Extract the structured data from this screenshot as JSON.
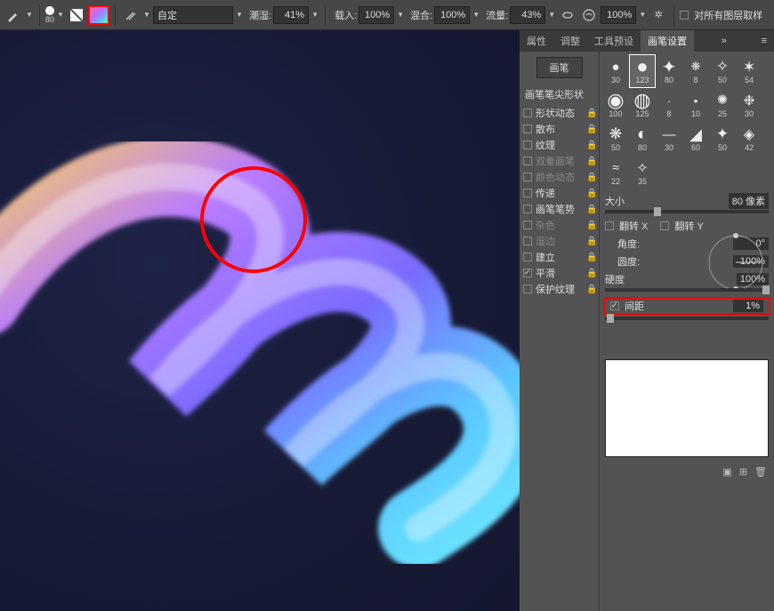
{
  "toolbar": {
    "brush_size": "80",
    "mode_value": "自定",
    "opacity_label": "潮湿:",
    "opacity_value": "41%",
    "load_label": "载入:",
    "load_value": "100%",
    "mix_label": "混合:",
    "mix_value": "100%",
    "flow_label": "流量:",
    "flow_value": "43%",
    "smooth_value": "100%",
    "all_layers_label": "对所有图层取样"
  },
  "tabs": {
    "t1": "属性",
    "t2": "调整",
    "t3": "工具预设",
    "t4": "画笔设置",
    "more": "»"
  },
  "sidebar": {
    "brush_btn": "画笔",
    "tip_shape": "画笔笔尖形状",
    "opts": [
      {
        "label": "形状动态",
        "enabled": true,
        "checked": false
      },
      {
        "label": "散布",
        "enabled": true,
        "checked": false
      },
      {
        "label": "纹理",
        "enabled": true,
        "checked": false
      },
      {
        "label": "双重画笔",
        "enabled": false,
        "checked": false
      },
      {
        "label": "颜色动态",
        "enabled": false,
        "checked": false
      },
      {
        "label": "传递",
        "enabled": true,
        "checked": false
      },
      {
        "label": "画笔笔势",
        "enabled": true,
        "checked": false
      },
      {
        "label": "杂色",
        "enabled": false,
        "checked": false
      },
      {
        "label": "湿边",
        "enabled": false,
        "checked": false
      },
      {
        "label": "建立",
        "enabled": true,
        "checked": false
      },
      {
        "label": "平滑",
        "enabled": true,
        "checked": true
      },
      {
        "label": "保护纹理",
        "enabled": true,
        "checked": false
      }
    ]
  },
  "thumbs": [
    {
      "sz": "30"
    },
    {
      "sz": "123",
      "sel": true
    },
    {
      "sz": "80"
    },
    {
      "sz": "8"
    },
    {
      "sz": "50"
    },
    {
      "sz": "54"
    },
    {
      "sz": "100"
    },
    {
      "sz": "125"
    },
    {
      "sz": "8"
    },
    {
      "sz": "10"
    },
    {
      "sz": "25"
    },
    {
      "sz": "30"
    },
    {
      "sz": "50"
    },
    {
      "sz": "80"
    },
    {
      "sz": "30"
    },
    {
      "sz": "60"
    },
    {
      "sz": "50"
    },
    {
      "sz": "42"
    },
    {
      "sz": "22"
    },
    {
      "sz": "35"
    }
  ],
  "props": {
    "size_label": "大小",
    "size_value": "80 像素",
    "flipx_label": "翻转 X",
    "flipy_label": "翻转 Y",
    "angle_label": "角度:",
    "angle_value": "0°",
    "round_label": "圆度:",
    "round_value": "100%",
    "hard_label": "硬度",
    "hard_value": "100%",
    "spacing_label": "间距",
    "spacing_value": "1%"
  },
  "footer": {
    "new": "新建",
    "trash": "删除"
  }
}
